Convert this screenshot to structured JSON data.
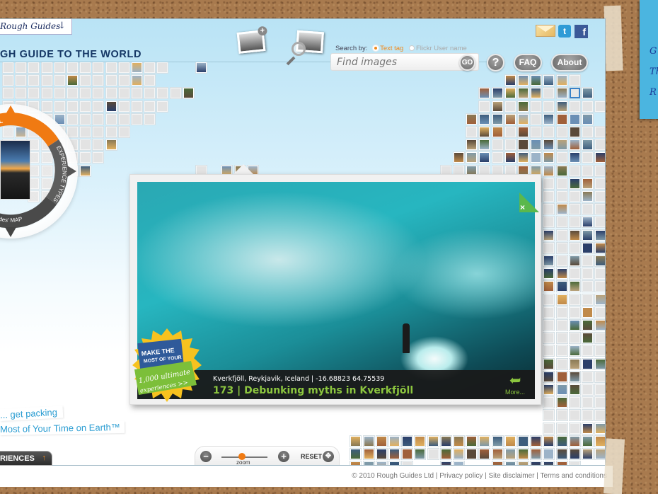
{
  "header": {
    "brand": "Rough Guides",
    "brand_arrow": "↓",
    "title": "GH GUIDE TO THE WORLD"
  },
  "share": {
    "email": "email-icon",
    "twitter": "t",
    "facebook": "f"
  },
  "search": {
    "search_by_label": "Search by:",
    "options": [
      {
        "label": "Text tag",
        "selected": true
      },
      {
        "label": "Flickr User name",
        "selected": false
      }
    ],
    "placeholder": "Find images",
    "go_label": "GO"
  },
  "nav": {
    "help_label": "?",
    "faq_label": "FAQ",
    "about_label": "About"
  },
  "compass": {
    "show_all": "SHOW ALL",
    "experience_types": "EXPERIENCE TYPES",
    "map_label": "RoughGuides' MAP"
  },
  "popup": {
    "location": "Kverkfjöll, Reykjavik, Iceland | -16.68823 64.75539",
    "title": "173 | Debunking myths in Kverkfjöll",
    "more_label": "More...",
    "close_label": "×",
    "promo": {
      "line1": "MAKE THE",
      "line2": "MOST OF YOUR",
      "line3": "1,000 ultimate",
      "line4": "experiences >>"
    }
  },
  "bottom_left": {
    "tagline1": "... get packing",
    "tagline2": "Most of Your Time on Earth™",
    "experiences_tab": "RIENCES",
    "experiences_arrow": "↑"
  },
  "zoom_control": {
    "minus": "−",
    "plus": "+",
    "zoom_label": "zoom",
    "zoom_level": 0.45,
    "reset_label": "RESET"
  },
  "footer": {
    "copyright": "© 2010 Rough Guides Ltd",
    "links": [
      "Privacy policy",
      "Site disclaimer",
      "Terms and conditions"
    ]
  },
  "sticky_note": {
    "lines": [
      "G",
      "Th",
      "R"
    ]
  }
}
